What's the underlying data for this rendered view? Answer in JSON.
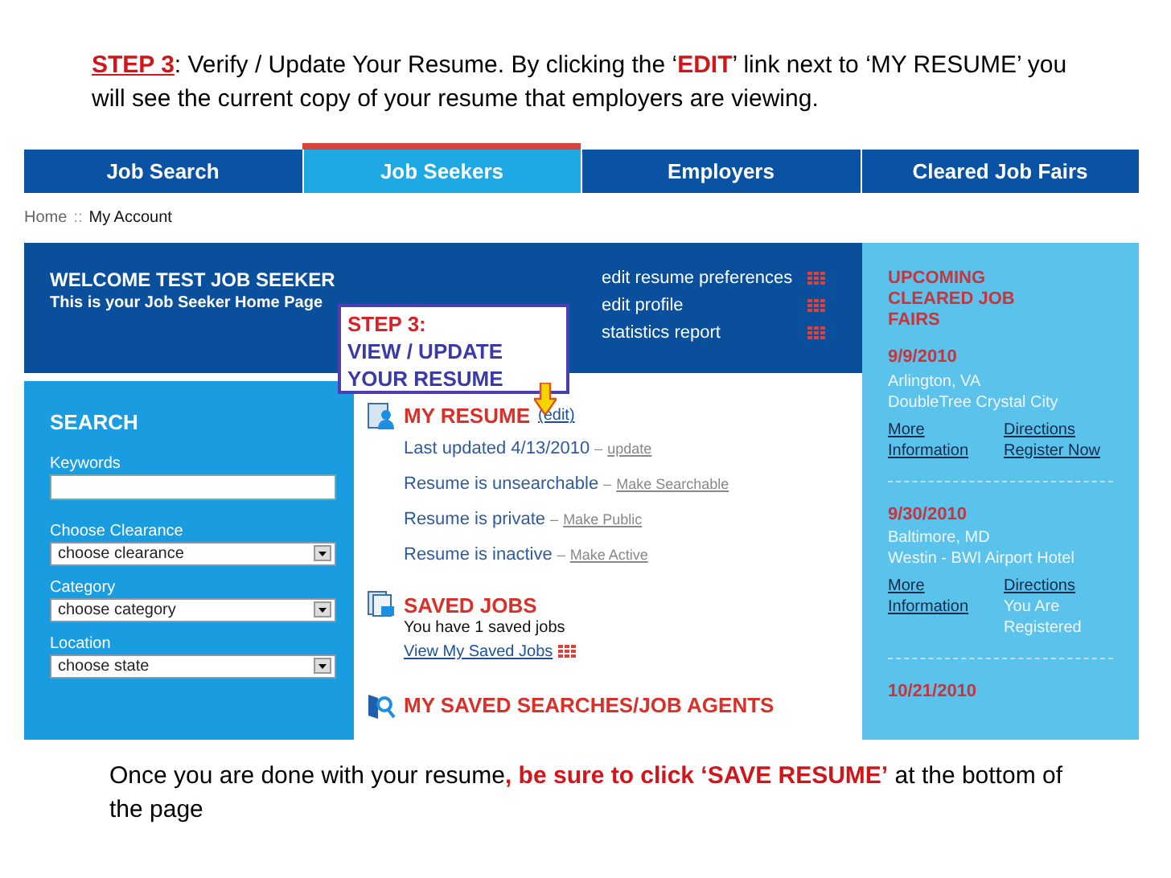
{
  "intro": [
    {
      "kind": "step",
      "text": "STEP 3"
    },
    {
      "kind": "plain",
      "text": ": Verify / Update Your Resume.  By clicking the ‘"
    },
    {
      "kind": "highlight",
      "text": "EDIT"
    },
    {
      "kind": "plain",
      "text": "’ link next to ‘MY RESUME’ you will see the current copy of your resume that employers are viewing."
    }
  ],
  "nav": [
    {
      "label": "Job Search",
      "selected": false
    },
    {
      "label": "Job Seekers",
      "selected": true
    },
    {
      "label": "Employers",
      "selected": false
    },
    {
      "label": "Cleared Job Fairs",
      "selected": false
    }
  ],
  "breadcrumb": [
    "Home",
    "::",
    "My Account"
  ],
  "welcome": {
    "title": "WELCOME TEST JOB SEEKER",
    "subtitle": "This is your Job Seeker Home Page",
    "links": [
      "edit resume preferences",
      "edit profile",
      "statistics report"
    ]
  },
  "callout": {
    "step": "STEP 3:",
    "text": "VIEW / UPDATE YOUR RESUME"
  },
  "search": {
    "title": "SEARCH",
    "fields": [
      {
        "kind": "text",
        "label": "Keywords"
      },
      {
        "kind": "select",
        "label": "Choose Clearance",
        "value": "choose clearance"
      },
      {
        "kind": "select",
        "label": "Category",
        "value": "choose category"
      },
      {
        "kind": "select",
        "label": "Location",
        "value": "choose state"
      }
    ]
  },
  "resume": {
    "title": "MY RESUME",
    "edit": "(edit)",
    "rows": [
      {
        "text": "Last updated 4/13/2010",
        "sep": "–",
        "action": "update"
      },
      {
        "text": "Resume is unsearchable",
        "sep": "–",
        "action": "Make Searchable"
      },
      {
        "text": "Resume is private",
        "sep": "–",
        "action": "Make Public"
      },
      {
        "text": "Resume is inactive",
        "sep": "–",
        "action": "Make Active"
      }
    ]
  },
  "saved_jobs": {
    "title": "SAVED JOBS",
    "text": "You have 1 saved jobs",
    "link": "View My Saved Jobs"
  },
  "saved_searches": {
    "title": "MY SAVED SEARCHES/JOB AGENTS"
  },
  "fairs": {
    "title": "UPCOMING CLEARED JOB FAIRS",
    "items": [
      {
        "date": "9/9/2010",
        "city": "Arlington, VA",
        "venue": "DoubleTree Crystal City",
        "info": "More Information",
        "right": [
          {
            "kind": "link",
            "text": "Directions"
          },
          {
            "kind": "link",
            "text": "Register Now"
          }
        ]
      },
      {
        "date": "9/30/2010",
        "city": "Baltimore, MD",
        "venue": "Westin - BWI Airport Hotel",
        "info": "More Information",
        "right": [
          {
            "kind": "link",
            "text": "Directions"
          },
          {
            "kind": "note",
            "text": "You Are Registered"
          }
        ]
      },
      {
        "date": "10/21/2010"
      }
    ]
  },
  "outro": [
    {
      "kind": "plain",
      "text": "Once you are done with your resume"
    },
    {
      "kind": "highlight",
      "text": ", be sure to click ‘SAVE RESUME’"
    },
    {
      "kind": "plain",
      "text": " at the bottom of the page"
    }
  ]
}
